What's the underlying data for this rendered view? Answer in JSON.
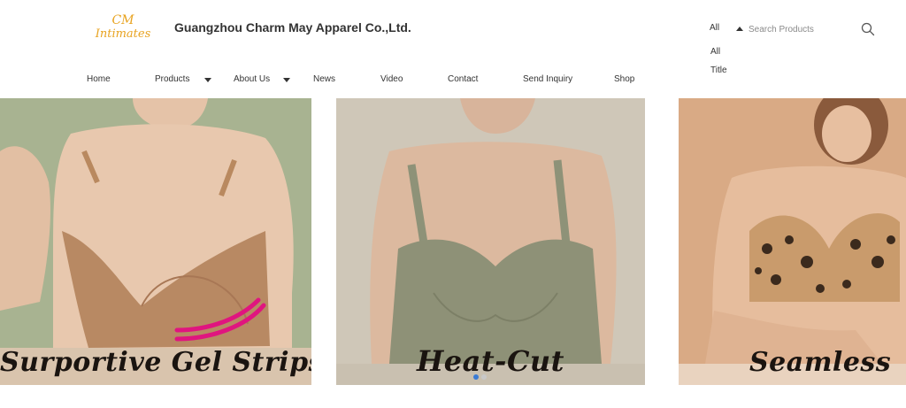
{
  "logo": {
    "line1": "CM",
    "line2": "Intimates"
  },
  "company_name": "Guangzhou Charm May Apparel Co.,Ltd.",
  "search": {
    "scope_label": "All",
    "placeholder": "Search Products",
    "scope_options": [
      "All",
      "Title"
    ]
  },
  "nav": {
    "items": [
      {
        "label": "Home"
      },
      {
        "label": "Products"
      },
      {
        "label": "About Us"
      },
      {
        "label": "News"
      },
      {
        "label": "Video"
      },
      {
        "label": "Contact"
      },
      {
        "label": "Send Inquiry"
      },
      {
        "label": "Shop"
      }
    ]
  },
  "slides": [
    {
      "caption": "Surportive Gel Strips"
    },
    {
      "caption": "Heat-Cut"
    },
    {
      "caption": "Seamless"
    }
  ],
  "carousel": {
    "active_index": 0,
    "dot_count": 2
  },
  "colors": {
    "logo": "#e8a320",
    "accent_strip": "#e0157f",
    "dot_active": "#3a7bd5",
    "dot_inactive": "#c8c8c8"
  }
}
